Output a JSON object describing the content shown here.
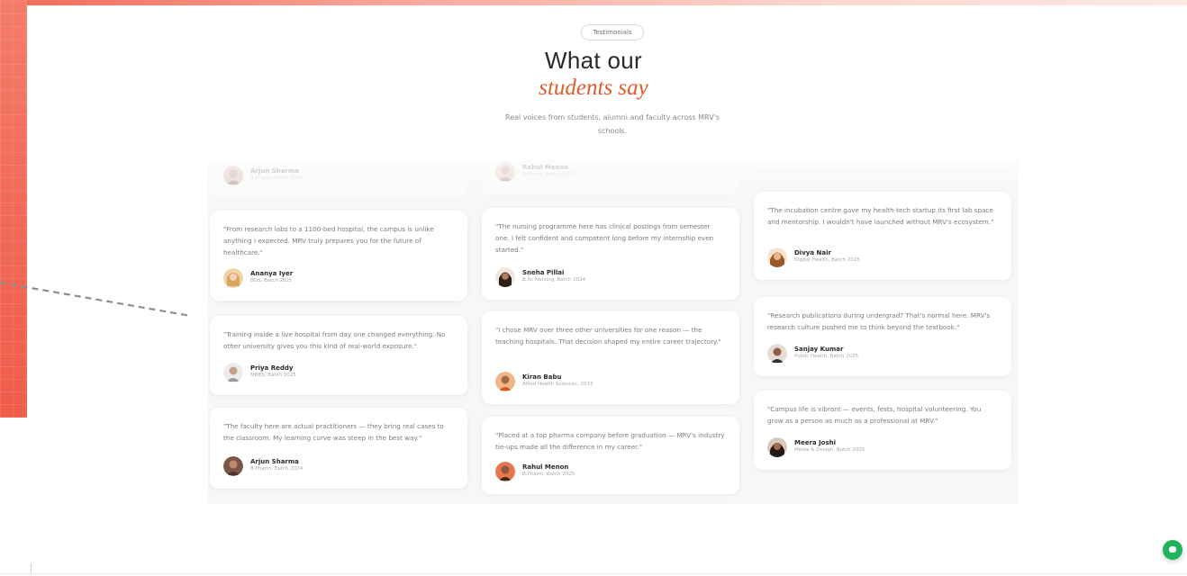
{
  "header": {
    "pill": "Testimonials",
    "headline": "What our",
    "headline_accent": "students say",
    "subtitle": "Real voices from students, alumni and faculty across MRV's schools."
  },
  "colors": {
    "accent": "#e35a2b",
    "band": "#f26a58",
    "chat": "#1fb45b"
  },
  "columns": [
    [
      {
        "quote": "",
        "name": "Arjun Sharma",
        "role": "B.Pharm, Batch 2024",
        "avatar": "a1",
        "faded": true
      },
      {
        "quote": "\"From research labs to a 1100-bed hospital, the campus is unlike anything I expected. MRV truly prepares you for the future of healthcare.\"",
        "name": "Ananya Iyer",
        "role": "BDS, Batch 2025",
        "avatar": "a2"
      },
      {
        "quote": "\"Training inside a live hospital from day one changed everything. No other university gives you this kind of real-world exposure.\"",
        "name": "Priya Reddy",
        "role": "MBBS, Batch 2025",
        "avatar": "a3"
      },
      {
        "quote": "\"The faculty here are actual practitioners — they bring real cases to the classroom. My learning curve was steep in the best way.\"",
        "name": "Arjun Sharma",
        "role": "B.Pharm, Batch 2024",
        "avatar": "a4"
      }
    ],
    [
      {
        "quote": "",
        "name": "Rahul Menon",
        "role": "B.Pharm, Batch 2025",
        "avatar": "a5",
        "faded": true
      },
      {
        "quote": "\"The nursing programme here has clinical postings from semester one. I felt confident and competent long before my internship even started.\"",
        "name": "Sneha Pillai",
        "role": "B.Sc Nursing, Batch 2024",
        "avatar": "a6"
      },
      {
        "quote": "\"I chose MRV over three other universities for one reason — the teaching hospitals. That decision shaped my entire career trajectory.\"",
        "name": "Kiran Babu",
        "role": "Allied Health Sciences, 2023",
        "avatar": "a7"
      },
      {
        "quote": "\"Placed at a top pharma company before graduation — MRV's industry tie-ups made all the difference in my career.\"",
        "name": "Rahul Menon",
        "role": "B.Pharm, Batch 2025",
        "avatar": "a8"
      }
    ],
    [
      {
        "quote": "",
        "name": "",
        "role": "",
        "avatar": "",
        "faded": true
      },
      {
        "quote": "\"The incubation centre gave my health-tech startup its first lab space and mentorship. I wouldn't have launched without MRV's ecosystem.\"",
        "name": "Divya Nair",
        "role": "Digital Health, Batch 2025",
        "avatar": "a9"
      },
      {
        "quote": "\"Research publications during undergrad? That's normal here. MRV's research culture pushed me to think beyond the textbook.\"",
        "name": "Sanjay Kumar",
        "role": "Public Health, Batch 2025",
        "avatar": "a10"
      },
      {
        "quote": "\"Campus life is vibrant — events, fests, hospital volunteering. You grow as a person as much as a professional at MRV.\"",
        "name": "Meera Joshi",
        "role": "Media & Design, Batch 2025",
        "avatar": "a11"
      }
    ]
  ],
  "chat": {
    "icon": "chat-bubble-icon"
  }
}
